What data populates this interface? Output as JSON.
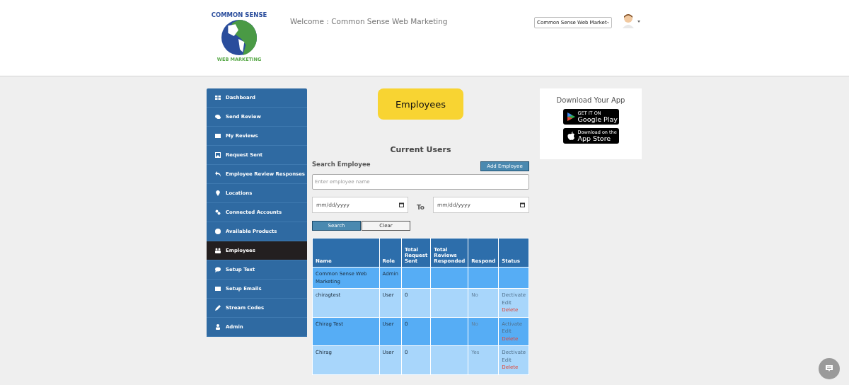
{
  "header": {
    "logo": {
      "top_text": "COMMON SENSE",
      "bottom_text": "WEB MARKETING"
    },
    "welcome": "Welcome : Common Sense Web Marketing",
    "account_select": "Common Sense Web Market"
  },
  "sidebar": {
    "items": [
      {
        "label": "Dashboard",
        "selected": false
      },
      {
        "label": "Send Review",
        "selected": false
      },
      {
        "label": "My Reviews",
        "selected": false
      },
      {
        "label": "Request Sent",
        "selected": false
      },
      {
        "label": "Employee Review Responses",
        "selected": false
      },
      {
        "label": "Locations",
        "selected": false
      },
      {
        "label": "Connected Accounts",
        "selected": false
      },
      {
        "label": "Available Products",
        "selected": false
      },
      {
        "label": "Employees",
        "selected": true
      },
      {
        "label": "Setup Text",
        "selected": false
      },
      {
        "label": "Setup Emails",
        "selected": false
      },
      {
        "label": "Stream Codes",
        "selected": false
      },
      {
        "label": "Admin",
        "selected": false
      }
    ]
  },
  "page_title": "Employees",
  "section_title": "Current Users",
  "search": {
    "label": "Search Employee",
    "add_button": "Add Employee",
    "name_placeholder": "Enter employee name",
    "from_placeholder": "mm/dd/yyyy",
    "to_label": "To",
    "to_placeholder": "mm/dd/yyyy",
    "search_button": "Search",
    "clear_button": "Clear"
  },
  "table": {
    "columns": [
      "Name",
      "Role",
      "Total Request Sent",
      "Total Reviews Responded",
      "Respond",
      "Status"
    ],
    "rows": [
      {
        "name": "Common Sense Web Marketing",
        "role": "Admin",
        "sent": "",
        "responded": "",
        "respond": "",
        "actions": []
      },
      {
        "name": "chiragtest",
        "role": "User",
        "sent": "0",
        "responded": "",
        "respond": "No",
        "actions": [
          {
            "label": "Dectivate",
            "kind": "toggle"
          },
          {
            "label": "Edit",
            "kind": "edit"
          },
          {
            "label": "Delete",
            "kind": "delete"
          }
        ]
      },
      {
        "name": "Chirag Test",
        "role": "User",
        "sent": "0",
        "responded": "",
        "respond": "No",
        "actions": [
          {
            "label": "Activate",
            "kind": "toggle"
          },
          {
            "label": "Edit",
            "kind": "edit"
          },
          {
            "label": "Delete",
            "kind": "delete"
          }
        ]
      },
      {
        "name": "Chirag",
        "role": "User",
        "sent": "0",
        "responded": "",
        "respond": "Yes",
        "actions": [
          {
            "label": "Dectivate",
            "kind": "toggle"
          },
          {
            "label": "Edit",
            "kind": "edit"
          },
          {
            "label": "Delete",
            "kind": "delete"
          }
        ]
      }
    ]
  },
  "app_card": {
    "title": "Download Your App",
    "badges": [
      {
        "kind": "google",
        "small": "GET IT ON",
        "big": "Google Play"
      },
      {
        "kind": "apple",
        "small": "Download on the",
        "big": "App Store"
      }
    ]
  }
}
